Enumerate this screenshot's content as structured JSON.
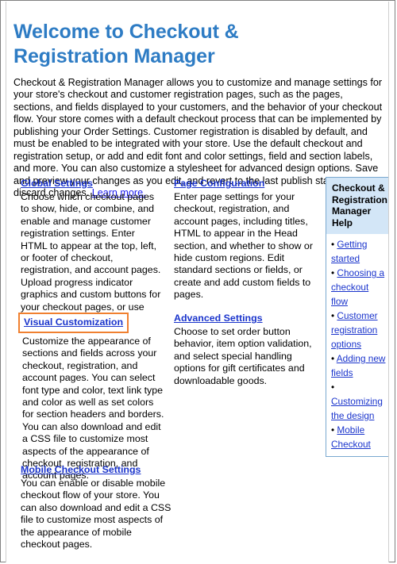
{
  "page": {
    "title": "Welcome to Checkout & Registration Manager",
    "intro": "Checkout & Registration Manager allows you to customize and manage settings for your store's checkout and customer registration pages, such as the pages, sections, and fields displayed to your customers, and the behavior of your checkout flow. Your store comes with a default checkout process that can be implemented by publishing your Order Settings. Customer registration is disabled by default, and must be enabled to be integrated with your store. Use the default checkout and registration setup, or add and edit font and color settings, field and section labels, and more. You can also customize a stylesheet for advanced design options. Save and preview your changes as you edit, and revert to the last publish state to discard changes. ",
    "intro_link": "Learn more."
  },
  "sections": [
    {
      "id": "global-settings",
      "heading": "Global Settings",
      "body": "Choose which checkout pages to show, hide, or combine, and enable and manage customer registration settings. Enter HTML to appear at the top, left, or footer of checkout, registration, and account pages. Upload progress indicator graphics and custom buttons for your checkout pages, or use text links.",
      "highlighted": false
    },
    {
      "id": "page-configuration",
      "heading": "Page Configuration",
      "body": "Enter page settings for your checkout, registration, and account pages, including titles, HTML to appear in the Head section, and whether to show or hide custom regions. Edit standard sections or fields, or create and add custom fields to pages.",
      "highlighted": false
    },
    {
      "id": "visual-customization",
      "heading": "Visual Customization",
      "body": "Customize the appearance of sections and fields across your checkout, registration, and account pages. You can select font type and color, text link type and color as well as set colors for section headers and borders. You can also download and edit a CSS file to customize most aspects of the appearance of checkout, registration, and account pages.",
      "highlighted": true
    },
    {
      "id": "advanced-settings",
      "heading": "Advanced Settings",
      "body": "Choose to set order button behavior, item option validation, and select special handling options for gift certificates and downloadable goods.",
      "highlighted": false
    },
    {
      "id": "mobile-checkout-settings",
      "heading": "Mobile Checkout Settings",
      "body": "You can enable or disable mobile checkout flow of your store. You can also download and edit a CSS file to customize most aspects of the appearance of mobile checkout pages.",
      "highlighted": false
    }
  ],
  "help_panel": {
    "title": "Checkout & Registration Manager Help",
    "bullet": "•",
    "links": [
      "Getting started",
      "Choosing a checkout flow",
      "Customer registration options",
      "Adding new fields",
      "Customizing the design",
      "Mobile Checkout"
    ]
  },
  "colors": {
    "title_blue": "#2e7cc4",
    "link_blue": "#1a34cc",
    "highlight_orange": "#f08030",
    "help_header_bg": "#d3e6f7",
    "help_border": "#7aa9d0",
    "window_border": "#808080"
  }
}
